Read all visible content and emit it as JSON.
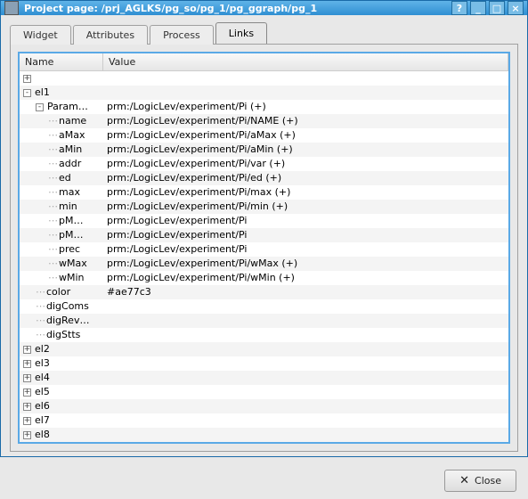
{
  "title": "Project page: /prj_AGLKS/pg_so/pg_1/pg_ggraph/pg_1",
  "titlebar_buttons": {
    "help": "?",
    "min": "_",
    "max": "□",
    "close": "×"
  },
  "tabs": [
    "Widget",
    "Attributes",
    "Process",
    "Links"
  ],
  "active_tab": 3,
  "columns": {
    "name": "Name",
    "value": "Value"
  },
  "tree": [
    {
      "depth": 0,
      "exp": "+",
      "name": "",
      "value": ""
    },
    {
      "depth": 0,
      "exp": "-",
      "name": "el1",
      "value": ""
    },
    {
      "depth": 1,
      "exp": "-",
      "name": "Param…",
      "value": "prm:/LogicLev/experiment/Pi (+)"
    },
    {
      "depth": 2,
      "exp": "",
      "name": "name",
      "value": "prm:/LogicLev/experiment/Pi/NAME (+)"
    },
    {
      "depth": 2,
      "exp": "",
      "name": "aMax",
      "value": "prm:/LogicLev/experiment/Pi/aMax (+)"
    },
    {
      "depth": 2,
      "exp": "",
      "name": "aMin",
      "value": "prm:/LogicLev/experiment/Pi/aMin (+)"
    },
    {
      "depth": 2,
      "exp": "",
      "name": "addr",
      "value": "prm:/LogicLev/experiment/Pi/var (+)"
    },
    {
      "depth": 2,
      "exp": "",
      "name": "ed",
      "value": "prm:/LogicLev/experiment/Pi/ed (+)"
    },
    {
      "depth": 2,
      "exp": "",
      "name": "max",
      "value": "prm:/LogicLev/experiment/Pi/max (+)"
    },
    {
      "depth": 2,
      "exp": "",
      "name": "min",
      "value": "prm:/LogicLev/experiment/Pi/min (+)"
    },
    {
      "depth": 2,
      "exp": "",
      "name": "pM…",
      "value": "prm:/LogicLev/experiment/Pi"
    },
    {
      "depth": 2,
      "exp": "",
      "name": "pM…",
      "value": "prm:/LogicLev/experiment/Pi"
    },
    {
      "depth": 2,
      "exp": "",
      "name": "prec",
      "value": "prm:/LogicLev/experiment/Pi"
    },
    {
      "depth": 2,
      "exp": "",
      "name": "wMax",
      "value": "prm:/LogicLev/experiment/Pi/wMax (+)"
    },
    {
      "depth": 2,
      "exp": "",
      "name": "wMin",
      "value": "prm:/LogicLev/experiment/Pi/wMin (+)"
    },
    {
      "depth": 1,
      "exp": "",
      "name": "color",
      "value": "#ae77c3"
    },
    {
      "depth": 1,
      "exp": "",
      "name": "digComs",
      "value": ""
    },
    {
      "depth": 1,
      "exp": "",
      "name": "digRev…",
      "value": ""
    },
    {
      "depth": 1,
      "exp": "",
      "name": "digStts",
      "value": ""
    },
    {
      "depth": 0,
      "exp": "+",
      "name": "el2",
      "value": ""
    },
    {
      "depth": 0,
      "exp": "+",
      "name": "el3",
      "value": ""
    },
    {
      "depth": 0,
      "exp": "+",
      "name": "el4",
      "value": ""
    },
    {
      "depth": 0,
      "exp": "+",
      "name": "el5",
      "value": ""
    },
    {
      "depth": 0,
      "exp": "+",
      "name": "el6",
      "value": ""
    },
    {
      "depth": 0,
      "exp": "+",
      "name": "el7",
      "value": ""
    },
    {
      "depth": 0,
      "exp": "+",
      "name": "el8",
      "value": ""
    }
  ],
  "close_label": "Close"
}
